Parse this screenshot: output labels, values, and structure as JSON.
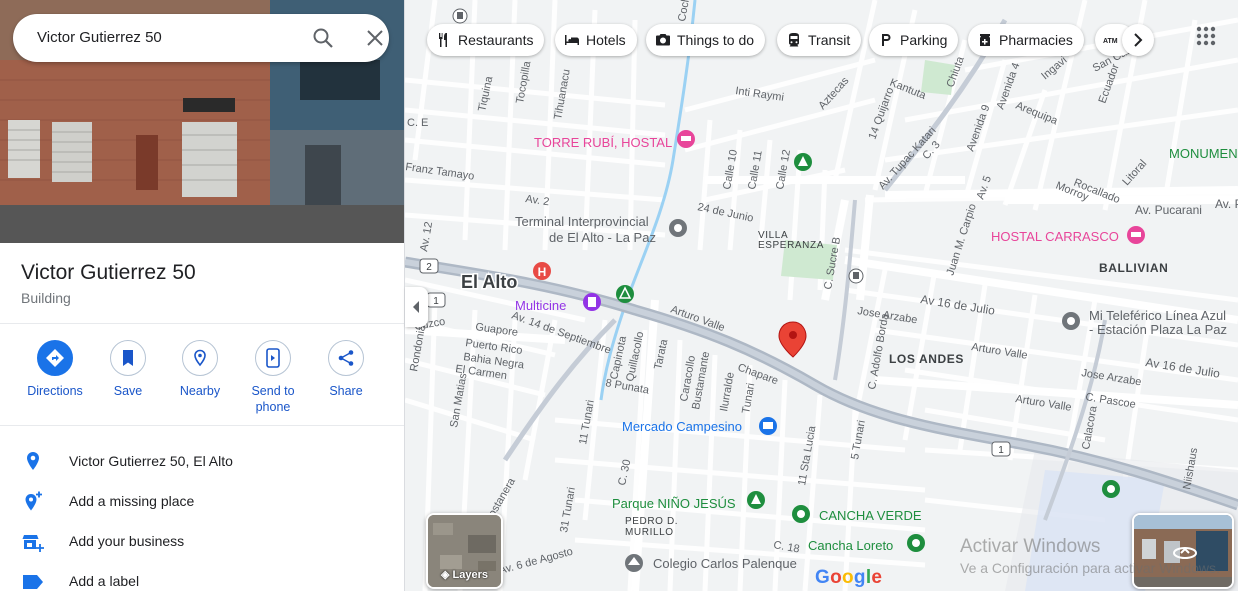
{
  "search": {
    "value": "Victor Gutierrez 50"
  },
  "place": {
    "title": "Victor Gutierrez 50",
    "category": "Building"
  },
  "actions": [
    {
      "label": "Directions",
      "icon": "directions-icon"
    },
    {
      "label": "Save",
      "icon": "bookmark-icon"
    },
    {
      "label": "Nearby",
      "icon": "nearby-icon"
    },
    {
      "label": "Send to phone",
      "label_line1": "Send to",
      "label_line2": "phone",
      "icon": "send-to-phone-icon"
    },
    {
      "label": "Share",
      "icon": "share-icon"
    }
  ],
  "info_rows": [
    {
      "text": "Victor Gutierrez 50, El Alto",
      "icon": "location-pin-icon"
    },
    {
      "text": "Add a missing place",
      "icon": "add-place-icon"
    },
    {
      "text": "Add your business",
      "icon": "add-business-icon"
    },
    {
      "text": "Add a label",
      "icon": "label-icon"
    }
  ],
  "chips": [
    {
      "label": "Restaurants",
      "icon": "fork-knife-icon"
    },
    {
      "label": "Hotels",
      "icon": "bed-icon"
    },
    {
      "label": "Things to do",
      "icon": "camera-icon"
    },
    {
      "label": "Transit",
      "icon": "train-icon"
    },
    {
      "label": "Parking",
      "icon": "parking-icon"
    },
    {
      "label": "Pharmacies",
      "icon": "pharmacy-icon"
    },
    {
      "label": "ATMs",
      "icon": "atm-icon"
    }
  ],
  "map": {
    "city_label": "El Alto",
    "places": {
      "torre_rubi": "TORRE RUBÍ, HOSTAL",
      "terminal_line1": "Terminal Interprovincial",
      "terminal_line2": "de El Alto - La Paz",
      "multicine": "Multicine",
      "hostal_carrasco": "HOSTAL CARRASCO",
      "teleferico_line1": "Mi Teleférico Línea Azul",
      "teleferico_line2": "- Estación Plaza La Paz",
      "mercado": "Mercado Campesino",
      "parque": "Parque NIÑO JESÚS",
      "cancha_verde": "CANCHA VERDE",
      "cancha_loreto": "Cancha Loreto",
      "colegio": "Colegio Carlos Palenque",
      "monumento": "MONUMEN"
    },
    "areas": {
      "villa_line1": "VILLA",
      "villa_line2": "ESPERANZA",
      "los_andes": "LOS ANDES",
      "ballivian": "BALLIVIAN",
      "pedro_line1": "PEDRO D.",
      "pedro_line2": "MURILLO"
    },
    "streets": {
      "av_pucarani": "Av. Pucarani",
      "av_16_julio_a": "Av 16 de Julio",
      "av_16_julio_b": "Av 16 de Julio",
      "jose_arzabe_a": "Jose Arzabe",
      "jose_arzabe_b": "Jose Arzabe",
      "arturo_valle_a": "Arturo Valle",
      "arturo_valle_b": "Arturo Valle",
      "av_tupac_katari": "Av. Tupac Katari",
      "chapare": "Chapare",
      "av_14_sept": "Av. 14 de Septiembre",
      "av_costanera": "Av. Costanera",
      "av_6_agosto": "Av. 6 de Agosto",
      "c_sucre_b": "C. Sucre B",
      "c_adolfo_borda": "C. Adolfo Borda",
      "calle_10": "Calle 10",
      "calle_11": "Calle 11",
      "calle_12": "Calle 12",
      "av_2": "Av. 2",
      "av_12": "Av. 12",
      "24_junio": "24 de Junio",
      "guapore": "Guapore",
      "puerto_rico": "Puerto Rico",
      "bahia_negra": "Bahia Negra",
      "el_carmen": "El Carmen",
      "caracollo": "Caracollo",
      "bustamante": "Bustamante",
      "ilurralde": "Ilurralde",
      "tunari_a": "Tunari",
      "tunari_b": "5 Tunari",
      "tunari_c": "31 Tunari",
      "tunari_d": "11 Tunari",
      "calacora": "Calacora",
      "c_pascoe": "C. Pascoe",
      "niishaus": "Niishaus",
      "rocallado": "Rocallado",
      "morroy": "Morroy",
      "litoral": "Litoral",
      "ingavi": "Ingavi",
      "arequipa": "Arequipa",
      "ecuador": "Ecuador",
      "san_castillo": "San Castillo",
      "franz_tamayo": "Franz Tamayo",
      "tiquina": "Tiquina",
      "tocopilla": "Tocopilla",
      "tihuanacu": "Tihuanacu",
      "inti_raymi": "Inti Raymi",
      "aztecas": "Aztecas",
      "kantuta": "Kantuta",
      "chiuta": "Chiuta",
      "av_5": "Av. 5",
      "av_9": "Avenida 9",
      "av_4": "Avenida 4",
      "juan_m_carpio": "Juan M. Carpio",
      "14_quijarro": "14 Quijarro",
      "santa_lucia": "11 Sta Lucia",
      "c_18": "C. 18",
      "c_e": "C. E",
      "c_3": "C. 3",
      "el_alto_route_1": "1",
      "el_alto_route_2": "2",
      "av_pu_right": "Av. Pu",
      "capinota": "Capinota",
      "quillacollo": "Quillacollo",
      "tarata": "Tarata",
      "punata": "8 Punata",
      "cochabamba": "Cocha",
      "c_30": "C. 30",
      "san_matias": "San Matias",
      "cuzco": "Cuzco",
      "rondonia": "Rondonia"
    }
  },
  "layers": {
    "label": "Layers"
  },
  "google_logo": {
    "letters": [
      "G",
      "o",
      "o",
      "g",
      "l",
      "e"
    ],
    "colors": [
      "#4285F4",
      "#EA4335",
      "#FBBC05",
      "#4285F4",
      "#34A853",
      "#EA4335"
    ]
  },
  "windows_watermark": {
    "title": "Activar Windows",
    "subtitle": "Ve a Configuración para activar Windows."
  },
  "colors": {
    "accent": "#1a73e8",
    "pin": "#ea4335",
    "park": "#1e8e3e",
    "hotel": "#e8459a",
    "shopping": "#1a73e8",
    "arterial": "#9aa6b7"
  }
}
